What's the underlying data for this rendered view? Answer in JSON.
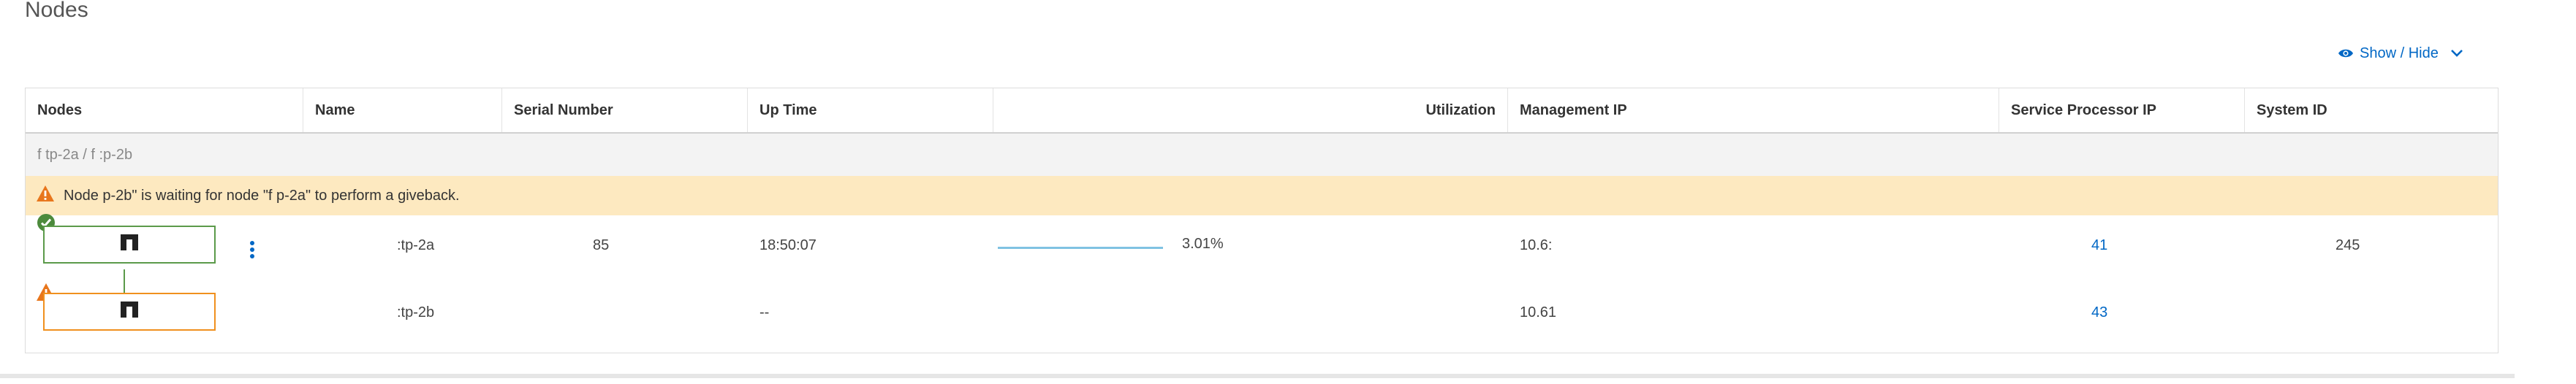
{
  "page": {
    "title": "Nodes"
  },
  "toolbar": {
    "show_hide_label": "Show / Hide"
  },
  "table": {
    "headers": {
      "nodes": "Nodes",
      "name": "Name",
      "serial_number": "Serial Number",
      "up_time": "Up Time",
      "utilization": "Utilization",
      "management_ip": "Management IP",
      "service_processor_ip": "Service Processor IP",
      "system_id": "System ID"
    },
    "group_label": "f             tp-2a / f              :p-2b",
    "warning_message": "Node              p-2b\" is waiting for node \"f              p-2a\" to perform a giveback.",
    "rows": [
      {
        "status": "ok",
        "name": ":tp-2a",
        "serial_number": "85",
        "up_time": "18:50:07",
        "utilization": "3.01%",
        "utilization_fraction": 0.0301,
        "management_ip": "10.6:",
        "service_processor_ip": "41",
        "system_id": "245"
      },
      {
        "status": "warning",
        "name": ":tp-2b",
        "serial_number": "",
        "up_time": "--",
        "utilization": "",
        "management_ip": "10.61",
        "service_processor_ip": "43",
        "system_id": ""
      }
    ]
  },
  "colors": {
    "accent": "#0067c5",
    "status_ok": "#5b9a4a",
    "status_warning": "#f0901e",
    "warning_background": "#fde9c0"
  },
  "icons": {
    "show_hide": "eye-icon",
    "dropdown": "chevron-down-icon",
    "node_ok": "check-circle-icon",
    "node_warning": "warning-triangle-icon",
    "node_hardware": "storage-node-icon",
    "row_actions": "kebab-menu-icon"
  }
}
